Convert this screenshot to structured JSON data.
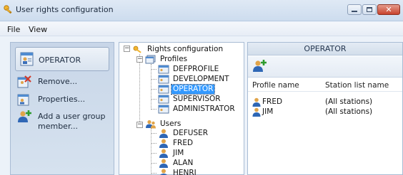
{
  "window": {
    "title": "User rights configuration",
    "controls": {
      "minimize": "minimize",
      "maximize": "maximize",
      "close": "close"
    }
  },
  "menu": {
    "items": [
      "File",
      "View"
    ]
  },
  "left_panel": {
    "header": "OPERATOR",
    "actions": [
      {
        "label": "Remove...",
        "icon": "remove-icon"
      },
      {
        "label": "Properties...",
        "icon": "properties-icon"
      },
      {
        "label": "Add a user group member...",
        "icon": "add-user-icon"
      }
    ]
  },
  "tree": {
    "root": "Rights configuration",
    "profiles_label": "Profiles",
    "profiles": [
      "DEFPROFILE",
      "DEVELOPMENT",
      "OPERATOR",
      "SUPERVISOR",
      "ADMINISTRATOR"
    ],
    "selected_profile": "OPERATOR",
    "users_label": "Users",
    "users": [
      "DEFUSER",
      "FRED",
      "JIM",
      "ALAN",
      "HENRI"
    ]
  },
  "right_panel": {
    "header": "OPERATOR",
    "columns": [
      "Profile name",
      "Station list name"
    ],
    "rows": [
      {
        "name": "FRED",
        "station": "(All stations)"
      },
      {
        "name": "JIM",
        "station": "(All stations)"
      }
    ]
  },
  "colors": {
    "selection": "#3399ff",
    "close_button": "#c8432d",
    "panel_bg": "#ecf2f9"
  }
}
